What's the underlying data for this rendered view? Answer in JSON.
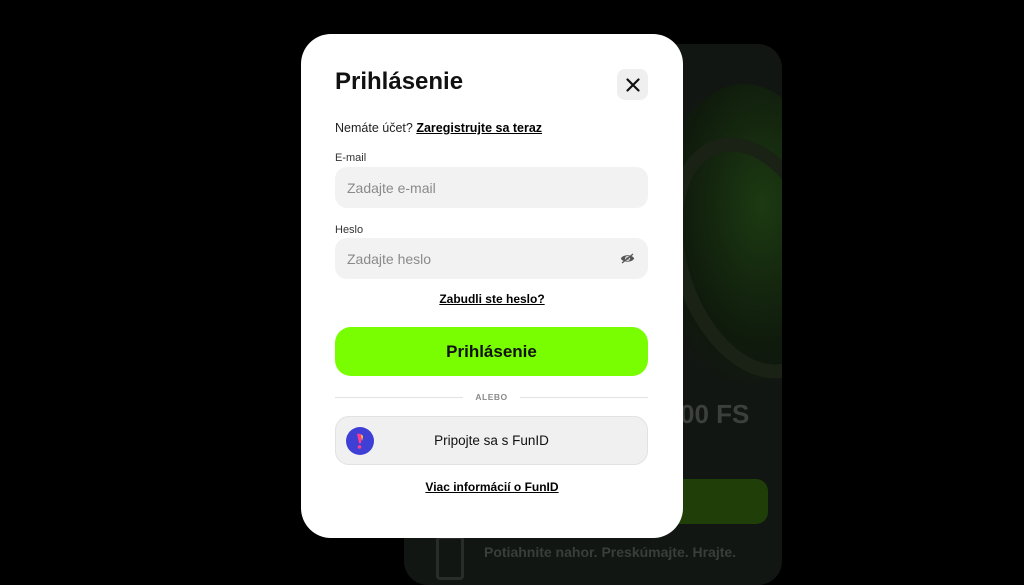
{
  "background": {
    "bonus_text": "00 FS",
    "tagline": "Potiahnite nahor. Preskúmajte. Hrajte."
  },
  "modal": {
    "title": "Prihlásenie",
    "close_icon": "close-icon",
    "register_prompt": "Nemáte účet?",
    "register_link": "Zaregistrujte sa teraz",
    "email": {
      "label": "E-mail",
      "placeholder": "Zadajte e-mail",
      "value": ""
    },
    "password": {
      "label": "Heslo",
      "placeholder": "Zadajte heslo",
      "value": "",
      "toggle_icon": "eye-icon"
    },
    "forgot_password": "Zabudli ste heslo?",
    "submit_label": "Prihlásenie",
    "divider_text": "ALEBO",
    "funid_button": "Pripojte sa s FunID",
    "funid_more": "Viac informácií o FunID"
  },
  "colors": {
    "accent": "#78fe00",
    "funid_logo": "#3f3fd6",
    "overlay": "#000000"
  }
}
